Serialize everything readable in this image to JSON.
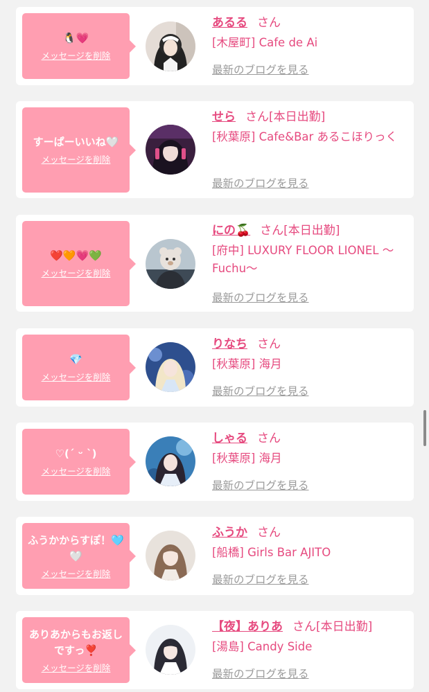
{
  "entries": [
    {
      "message": "🐧💗",
      "delete_label": "メッセージを削除",
      "name": "あるる",
      "honorific": "さん",
      "status": "",
      "shop": "[木屋町] Cafe de Ai",
      "blog_label": "最新のブログを見る"
    },
    {
      "message": "すーぱーいいね🤍",
      "delete_label": "メッセージを削除",
      "name": "せら",
      "honorific": "さん",
      "status": "[本日出勤]",
      "shop": "[秋葉原] Cafe&Bar あるこほりっく",
      "blog_label": "最新のブログを見る"
    },
    {
      "message": "❤️🧡💗💚",
      "delete_label": "メッセージを削除",
      "name": "にの🍒",
      "honorific": "さん",
      "status": "[本日出勤]",
      "shop": "[府中] LUXURY FLOOR LIONEL 〜Fuchu〜",
      "blog_label": "最新のブログを見る"
    },
    {
      "message": "💎",
      "delete_label": "メッセージを削除",
      "name": "りなち",
      "honorific": "さん",
      "status": "",
      "shop": "[秋葉原] 海月",
      "blog_label": "最新のブログを見る"
    },
    {
      "message": "♡(ˊ ᵕ ˋ)",
      "delete_label": "メッセージを削除",
      "name": "しゃる",
      "honorific": "さん",
      "status": "",
      "shop": "[秋葉原] 海月",
      "blog_label": "最新のブログを見る"
    },
    {
      "message": "ふうかからすぽ！🩵🤍",
      "delete_label": "メッセージを削除",
      "name": "ふうか",
      "honorific": "さん",
      "status": "",
      "shop": "[船橋] Girls Bar AJITO",
      "blog_label": "最新のブログを見る"
    },
    {
      "message": "ありあからもお返しですっ❣️",
      "delete_label": "メッセージを削除",
      "name": "【夜】ありあ",
      "honorific": "さん",
      "status": "[本日出勤]",
      "shop": "[湯島] Candy Side",
      "blog_label": "最新のブログを見る"
    }
  ]
}
